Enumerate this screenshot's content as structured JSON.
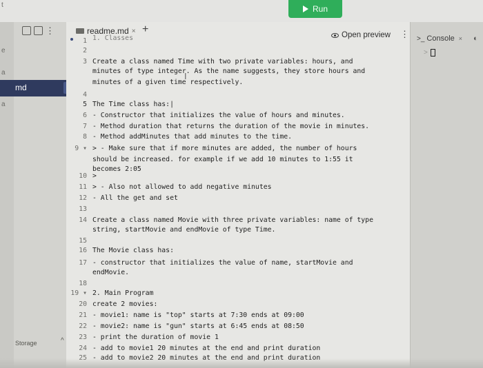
{
  "toolbar": {
    "run_label": "Run"
  },
  "left_fragments": [
    "t",
    "e",
    "a",
    "md",
    "a"
  ],
  "sidebar": {
    "active_file": "md",
    "storage_label": "Storage"
  },
  "editor": {
    "tab_name": "readme.md",
    "tab_close": "×",
    "add_tab": "+",
    "preview_label": "Open preview",
    "lines": [
      {
        "n": "1",
        "text": "1. Classes"
      },
      {
        "n": "2",
        "text": ""
      },
      {
        "n": "3",
        "text": "Create a class named Time with two private variables: hours, and"
      },
      {
        "n": "",
        "text": "minutes of type integer. As the name suggests, they store hours and"
      },
      {
        "n": "",
        "text": "minutes of a given time respectively."
      },
      {
        "n": "4",
        "text": ""
      },
      {
        "n": "5",
        "text": "The Time class has:|"
      },
      {
        "n": "6",
        "text": "- Constructor that initializes the value of hours and minutes."
      },
      {
        "n": "7",
        "text": "- Method duration that returns the duration of the movie in minutes."
      },
      {
        "n": "8",
        "text": "- Method addMinutes that add minutes to the time."
      },
      {
        "n": "9 ▾",
        "text": "> - Make sure that if more minutes are added, the number of hours"
      },
      {
        "n": "",
        "text": "should be increased. for example if we add 10 minutes to 1:55 it"
      },
      {
        "n": "",
        "text": "becomes 2:05"
      },
      {
        "n": "10",
        "text": ">"
      },
      {
        "n": "11",
        "text": "> - Also not allowed to add negative minutes"
      },
      {
        "n": "12",
        "text": "- All the get and set"
      },
      {
        "n": "13",
        "text": ""
      },
      {
        "n": "14",
        "text": "Create a class named Movie with three private variables: name of type"
      },
      {
        "n": "",
        "text": "string, startMovie and endMovie of type Time."
      },
      {
        "n": "15",
        "text": ""
      },
      {
        "n": "16",
        "text": "The Movie class has:"
      },
      {
        "n": "17",
        "text": "- constructor that initializes the value of name, startMovie and"
      },
      {
        "n": "",
        "text": "endMovie."
      },
      {
        "n": "18",
        "text": ""
      },
      {
        "n": "19 ▾",
        "text": "2. Main Program"
      },
      {
        "n": "20",
        "text": "create 2 movies:"
      },
      {
        "n": "21",
        "text": "- movie1: name is \"top\" starts at 7:30 ends at 09:00"
      },
      {
        "n": "22",
        "text": "- movie2: name is \"gun\" starts at 6:45 ends at 08:50"
      },
      {
        "n": "23",
        "text": "- print the duration of movie 1"
      },
      {
        "n": "24",
        "text": "- add to movie1 20 minutes at the end and print duration"
      },
      {
        "n": "25",
        "text": "- add to movie2 20 minutes at the end and print duration"
      }
    ]
  },
  "console": {
    "tab_label": "Console",
    "close": "×",
    "prompt_symbol": ">"
  }
}
